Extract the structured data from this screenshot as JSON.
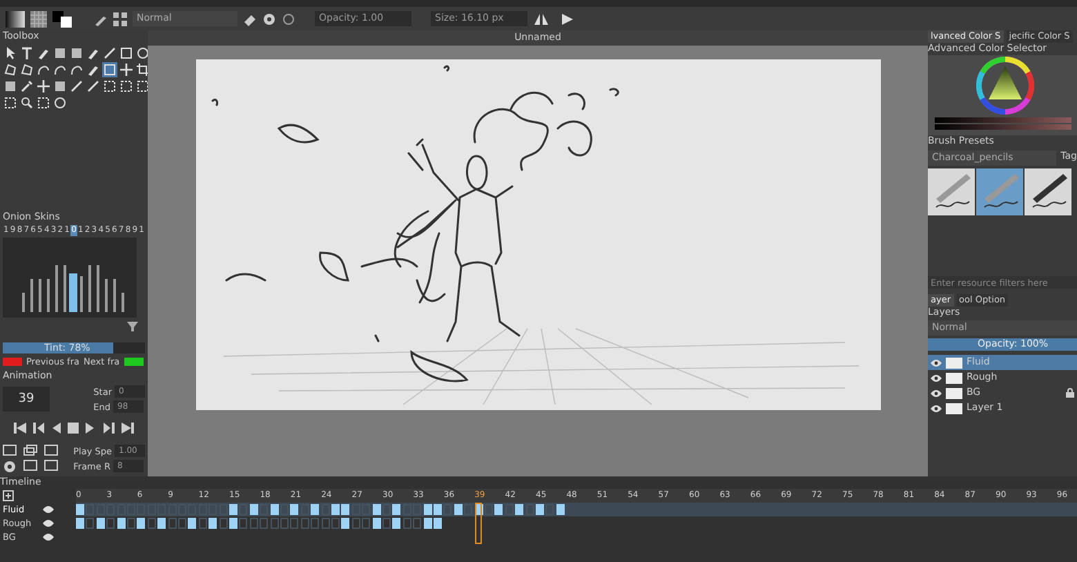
{
  "toolbar": {
    "blend_mode": "Normal",
    "opacity": "Opacity: 1.00",
    "size": "Size: 16.10 px"
  },
  "toolbox": {
    "title": "Toolbox",
    "tools": [
      {
        "kind": "pointer",
        "selected": false
      },
      {
        "kind": "text",
        "selected": false
      },
      {
        "kind": "brush",
        "selected": false
      },
      {
        "kind": "fill",
        "selected": false
      },
      {
        "kind": "fill",
        "selected": false
      },
      {
        "kind": "brush",
        "selected": false
      },
      {
        "kind": "line",
        "selected": false
      },
      {
        "kind": "rect",
        "selected": false
      },
      {
        "kind": "ellipse",
        "selected": false
      },
      {
        "kind": "poly",
        "selected": false
      },
      {
        "kind": "poly",
        "selected": false
      },
      {
        "kind": "curve",
        "selected": false
      },
      {
        "kind": "curve",
        "selected": false
      },
      {
        "kind": "curve",
        "selected": false
      },
      {
        "kind": "brush",
        "selected": false
      },
      {
        "kind": "rect",
        "selected": true
      },
      {
        "kind": "move",
        "selected": false
      },
      {
        "kind": "crop",
        "selected": false
      },
      {
        "kind": "fill",
        "selected": false
      },
      {
        "kind": "picker",
        "selected": false
      },
      {
        "kind": "move",
        "selected": false
      },
      {
        "kind": "fill",
        "selected": false
      },
      {
        "kind": "line",
        "selected": false
      },
      {
        "kind": "line",
        "selected": false
      },
      {
        "kind": "select",
        "selected": false
      },
      {
        "kind": "select",
        "selected": false
      },
      {
        "kind": "select",
        "selected": false
      },
      {
        "kind": "select",
        "selected": false
      },
      {
        "kind": "zoom",
        "selected": false
      },
      {
        "kind": "select",
        "selected": false
      },
      {
        "kind": "ellipse",
        "selected": false
      }
    ]
  },
  "onion_skins": {
    "title": "Onion Skins",
    "frames": [
      {
        "label": "1",
        "selected": false
      },
      {
        "label": "9",
        "selected": false
      },
      {
        "label": "8",
        "selected": false
      },
      {
        "label": "7",
        "selected": false
      },
      {
        "label": "6",
        "selected": false
      },
      {
        "label": "5",
        "selected": false
      },
      {
        "label": "4",
        "selected": false
      },
      {
        "label": "3",
        "selected": false
      },
      {
        "label": "2",
        "selected": false
      },
      {
        "label": "1",
        "selected": false
      },
      {
        "label": "0",
        "selected": true
      },
      {
        "label": "1",
        "selected": false
      },
      {
        "label": "2",
        "selected": false
      },
      {
        "label": "3",
        "selected": false
      },
      {
        "label": "4",
        "selected": false
      },
      {
        "label": "5",
        "selected": false
      },
      {
        "label": "6",
        "selected": false
      },
      {
        "label": "7",
        "selected": false
      },
      {
        "label": "8",
        "selected": false
      },
      {
        "label": "9",
        "selected": false
      },
      {
        "label": "1",
        "selected": false
      }
    ],
    "tint": {
      "label": "Tint: 78%",
      "level": 0.78
    },
    "colors": [
      {
        "label": "Previous fra",
        "color": "#e01c1c"
      },
      {
        "label": "Next fra",
        "color": "#1ec81e"
      }
    ]
  },
  "animation": {
    "title": "Animation",
    "current_frame": "39",
    "start_label": "Star",
    "start": "0",
    "end_label": "End",
    "end": "98",
    "play_speed_label": "Play Spe",
    "play_speed": "1.00",
    "frame_rate_label": "Frame R",
    "frame_rate": "8"
  },
  "canvas": {
    "title": "Unnamed"
  },
  "color_tabs": [
    {
      "label": "lvanced Color S",
      "selected": true
    },
    {
      "label": "jecific Color S",
      "selected": false
    }
  ],
  "color_selector": {
    "title": "Advanced Color Selector"
  },
  "brush_presets": {
    "title": "Brush Presets",
    "tag_set": "Charcoal_pencils",
    "tag_label": "Tag",
    "presets": [
      {
        "selected": false
      },
      {
        "selected": true
      },
      {
        "selected": false
      }
    ],
    "filter_placeholder": "Enter resource filters here"
  },
  "dock_tabs": [
    {
      "label": "ayer",
      "selected": true
    },
    {
      "label": "ool Option",
      "selected": false
    }
  ],
  "layers": {
    "title": "Layers",
    "blend_mode": "Normal",
    "opacity": "Opacity:  100%",
    "level": 1,
    "items": [
      {
        "name": "Fluid",
        "selected": true,
        "locked": false
      },
      {
        "name": "Rough",
        "selected": false,
        "locked": false
      },
      {
        "name": "BG",
        "selected": false,
        "locked": true
      },
      {
        "name": "Layer 1",
        "selected": false,
        "locked": false
      }
    ]
  },
  "timeline": {
    "title": "Timeline",
    "ticks": [
      {
        "label": "0",
        "selected": false
      },
      {
        "label": "3",
        "selected": false
      },
      {
        "label": "6",
        "selected": false
      },
      {
        "label": "9",
        "selected": false
      },
      {
        "label": "12",
        "selected": false
      },
      {
        "label": "15",
        "selected": false
      },
      {
        "label": "18",
        "selected": false
      },
      {
        "label": "21",
        "selected": false
      },
      {
        "label": "24",
        "selected": false
      },
      {
        "label": "27",
        "selected": false
      },
      {
        "label": "30",
        "selected": false
      },
      {
        "label": "33",
        "selected": false
      },
      {
        "label": "36",
        "selected": false
      },
      {
        "label": "39",
        "selected": true
      },
      {
        "label": "42",
        "selected": false
      },
      {
        "label": "45",
        "selected": false
      },
      {
        "label": "48",
        "selected": false
      },
      {
        "label": "51",
        "selected": false
      },
      {
        "label": "54",
        "selected": false
      },
      {
        "label": "57",
        "selected": false
      },
      {
        "label": "60",
        "selected": false
      },
      {
        "label": "63",
        "selected": false
      },
      {
        "label": "66",
        "selected": false
      },
      {
        "label": "69",
        "selected": false
      },
      {
        "label": "72",
        "selected": false
      },
      {
        "label": "75",
        "selected": false
      },
      {
        "label": "78",
        "selected": false
      },
      {
        "label": "81",
        "selected": false
      },
      {
        "label": "84",
        "selected": false
      },
      {
        "label": "87",
        "selected": false
      },
      {
        "label": "90",
        "selected": false
      },
      {
        "label": "93",
        "selected": false
      },
      {
        "label": "96",
        "selected": false
      }
    ],
    "rows": [
      {
        "name": "Fluid",
        "selected": true,
        "keyframes": [
          true,
          false,
          false,
          false,
          false,
          false,
          false,
          false,
          false,
          false,
          false,
          false,
          false,
          false,
          false,
          true,
          false,
          true,
          false,
          true,
          false,
          true,
          false,
          true,
          false,
          true,
          true,
          false,
          false,
          true,
          false,
          true,
          false,
          false,
          true,
          true,
          false,
          true,
          false,
          true,
          false,
          true,
          false,
          true,
          false,
          true,
          false,
          true
        ]
      },
      {
        "name": "Rough",
        "selected": false,
        "keyframes": [
          true,
          false,
          true,
          false,
          true,
          false,
          true,
          false,
          true,
          false,
          false,
          true,
          false,
          true,
          false,
          true,
          false,
          false,
          false,
          false,
          false,
          false,
          false,
          false,
          false,
          false,
          true,
          false,
          false,
          true,
          false,
          true,
          false,
          false,
          true,
          true
        ]
      },
      {
        "name": "BG",
        "selected": false
      }
    ]
  }
}
